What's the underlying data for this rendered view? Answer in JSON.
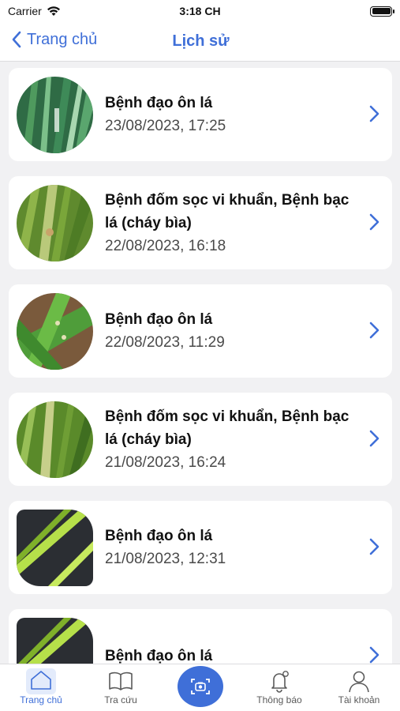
{
  "status_bar": {
    "carrier": "Carrier",
    "time": "3:18 CH"
  },
  "nav": {
    "back_label": "Trang chủ",
    "title": "Lịch sử"
  },
  "history": [
    {
      "title": "Bệnh đạo ôn lá",
      "date": "23/08/2023, 17:25"
    },
    {
      "title": "Bệnh đốm sọc vi khuẩn, Bệnh bạc lá (cháy bìa)",
      "date": "22/08/2023, 16:18"
    },
    {
      "title": "Bệnh đạo ôn lá",
      "date": "22/08/2023, 11:29"
    },
    {
      "title": "Bệnh đốm sọc vi khuẩn, Bệnh bạc lá (cháy bìa)",
      "date": "21/08/2023, 16:24"
    },
    {
      "title": "Bệnh đạo ôn lá",
      "date": "21/08/2023, 12:31"
    },
    {
      "title": "Bệnh đạo ôn lá",
      "date": ""
    }
  ],
  "tabs": [
    {
      "label": "Trang chủ",
      "icon": "home-icon",
      "active": true
    },
    {
      "label": "Tra cứu",
      "icon": "book-icon"
    },
    {
      "label": "",
      "icon": "camera-scan-icon"
    },
    {
      "label": "Thông báo",
      "icon": "bell-icon"
    },
    {
      "label": "Tài khoản",
      "icon": "user-icon"
    }
  ],
  "colors": {
    "accent": "#3f6fd8",
    "background": "#f1f1f3",
    "card": "#ffffff"
  }
}
